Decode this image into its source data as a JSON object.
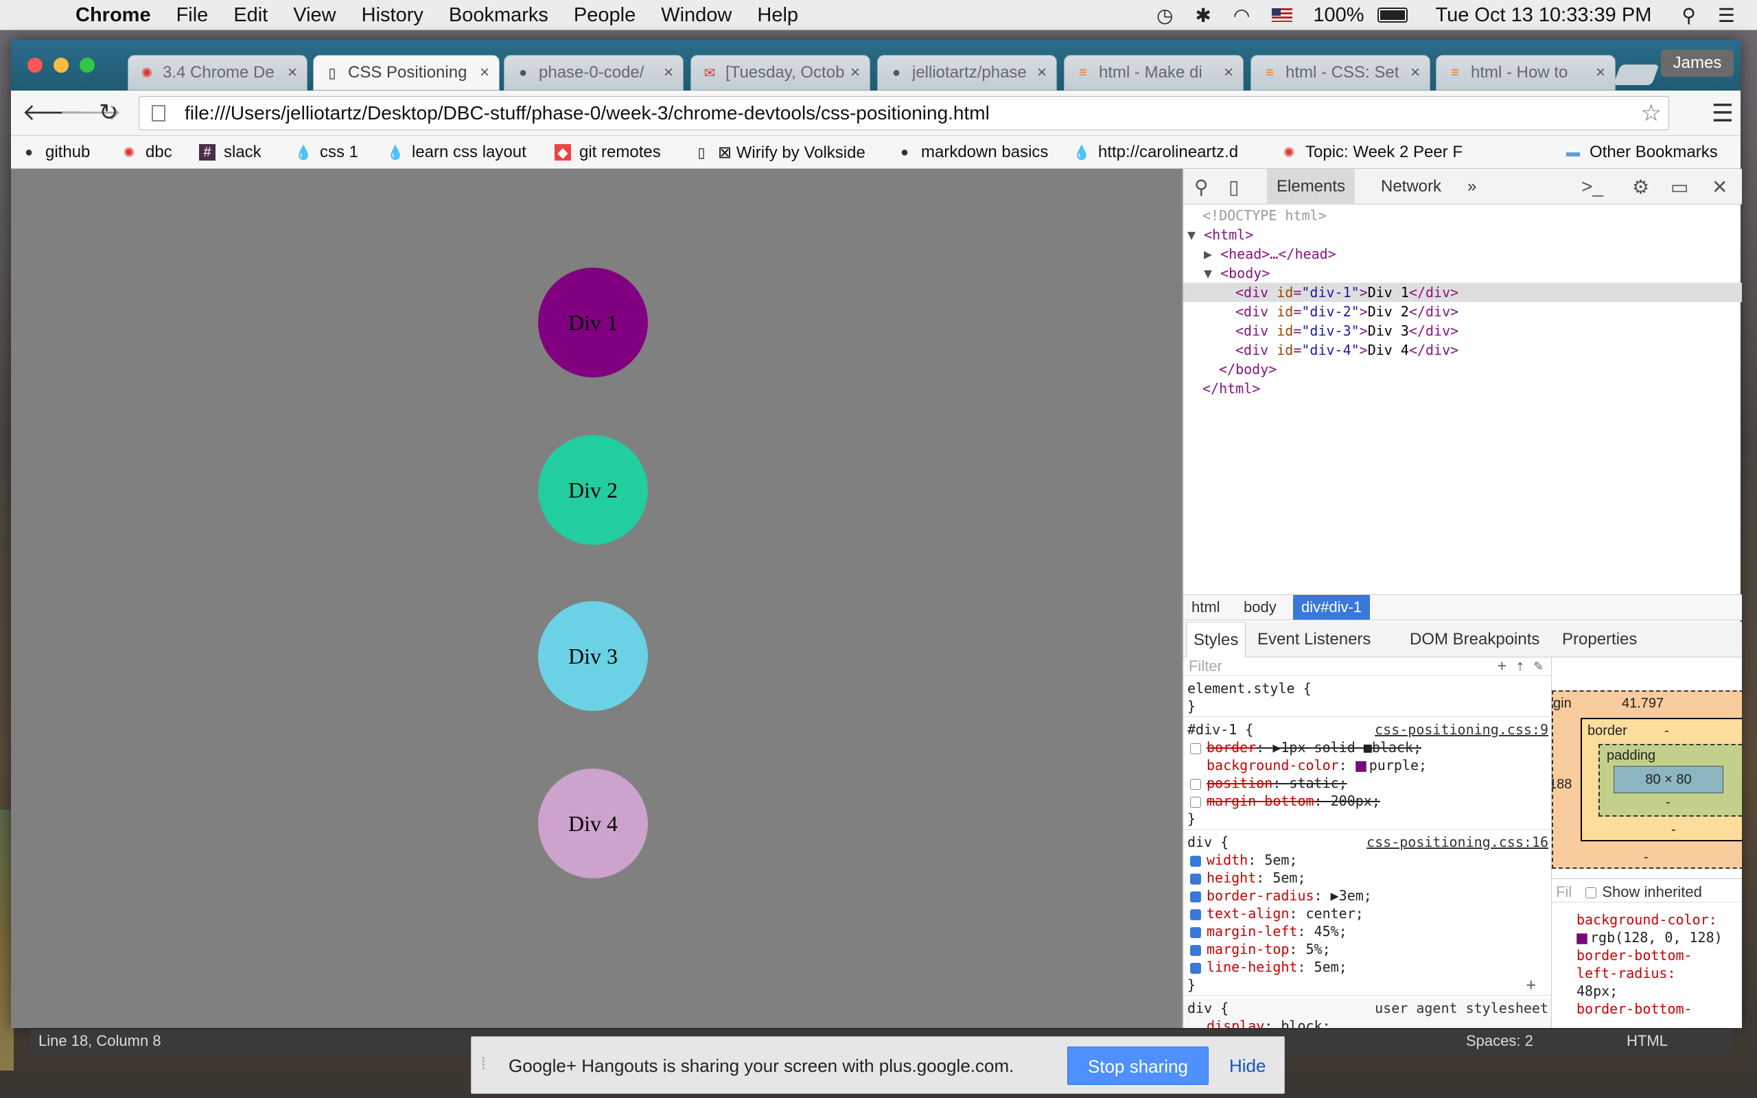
{
  "menubar": {
    "app": "Chrome",
    "items": [
      "File",
      "Edit",
      "View",
      "History",
      "Bookmarks",
      "People",
      "Window",
      "Help"
    ],
    "battery": "100%",
    "clock": "Tue Oct 13  10:33:39 PM"
  },
  "tabs": [
    {
      "title": "3.4 Chrome De",
      "icon": "dbc-icon"
    },
    {
      "title": "CSS Positioning",
      "icon": "page-icon",
      "active": true
    },
    {
      "title": "phase-0-code/",
      "icon": "github-icon"
    },
    {
      "title": "[Tuesday, Octob",
      "icon": "gmail-icon"
    },
    {
      "title": "jelliotartz/phase",
      "icon": "github-icon"
    },
    {
      "title": "html - Make di",
      "icon": "stackoverflow-icon"
    },
    {
      "title": "html - CSS: Set",
      "icon": "stackoverflow-icon"
    },
    {
      "title": "html - How to",
      "icon": "stackoverflow-icon"
    }
  ],
  "profile": "James",
  "url": "file:///Users/jelliotartz/Desktop/DBC-stuff/phase-0/week-3/chrome-devtools/css-positioning.html",
  "bookmarks": [
    "github",
    "dbc",
    "slack",
    "css 1",
    "learn css layout",
    "git remotes",
    "⊠ Wirify by Volkside",
    "markdown basics",
    "http://carolineartz.d",
    "Topic: Week 2 Peer F",
    "Other Bookmarks"
  ],
  "page": {
    "divs": [
      {
        "label": "Div 1",
        "color": "#800080"
      },
      {
        "label": "Div 2",
        "color": "#22cda0"
      },
      {
        "label": "Div 3",
        "color": "#6ad2e4"
      },
      {
        "label": "Div 4",
        "color": "#cda2cd"
      }
    ]
  },
  "devtools": {
    "tabs": {
      "elements": "Elements",
      "network": "Network",
      "more": "»"
    },
    "dom": {
      "doctype": "<!DOCTYPE html>",
      "html_open": "<html>",
      "head": "<head>…</head>",
      "body_open": "<body>",
      "div1_text": "Div 1",
      "div2_text": "Div 2",
      "div3_text": "Div 3",
      "div4_text": "Div 4",
      "body_close": "</body>",
      "html_close": "</html>"
    },
    "crumbs": [
      "html",
      "body",
      "div#div-1"
    ],
    "subtabs": [
      "Styles",
      "Event Listeners",
      "DOM Breakpoints",
      "Properties"
    ],
    "styles": {
      "filter": "Filter",
      "element_style": "element.style {",
      "rule1_selector": "#div-1 {",
      "rule1_source": "css-positioning.css:9",
      "rule1_props": [
        {
          "name": "border",
          "value": "▶1px solid ■black;",
          "strike": true,
          "checked": false
        },
        {
          "name": "background-color",
          "value": "purple;",
          "swatch": "#800080",
          "strike": false,
          "checked": null
        },
        {
          "name": "position",
          "value": "static;",
          "strike": true,
          "checked": false
        },
        {
          "name": "margin-bottom",
          "value": "200px;",
          "strike": true,
          "checked": false
        }
      ],
      "rule2_selector": "div {",
      "rule2_source": "css-positioning.css:16",
      "rule2_props": [
        {
          "name": "width",
          "value": "5em;"
        },
        {
          "name": "height",
          "value": "5em;"
        },
        {
          "name": "border-radius",
          "value": "▶3em;"
        },
        {
          "name": "text-align",
          "value": "center;"
        },
        {
          "name": "margin-left",
          "value": "45%;"
        },
        {
          "name": "margin-top",
          "value": "5%;"
        },
        {
          "name": "line-height",
          "value": "5em;"
        }
      ],
      "rule3_selector": "div {",
      "rule3_source": "user agent stylesheet",
      "rule3_prop": "display",
      "rule3_value": "block;",
      "close": "}"
    },
    "boxmodel": {
      "margin_label": "gin",
      "margin_top": "41.797",
      "margin_left": "188",
      "border_label": "border",
      "padding_label": "padding",
      "content": "80 × 80",
      "dash": "-"
    },
    "computed": {
      "filter": "Fil",
      "show_inherited": "Show inherited",
      "bg_prop": "background-color:",
      "bg_value": "rgb(128, 0, 128)",
      "bbl_prop1": "border-bottom-",
      "bbl_prop2": "left-radius:",
      "bbl_value": "48px;",
      "bbr_prop": "border-bottom-"
    }
  },
  "statusbar": {
    "position": "Line 18, Column 8",
    "spaces": "Spaces: 2",
    "syntax": "HTML"
  },
  "hangouts": {
    "message": "Google+ Hangouts is sharing your screen with plus.google.com.",
    "stop": "Stop sharing",
    "hide": "Hide"
  }
}
